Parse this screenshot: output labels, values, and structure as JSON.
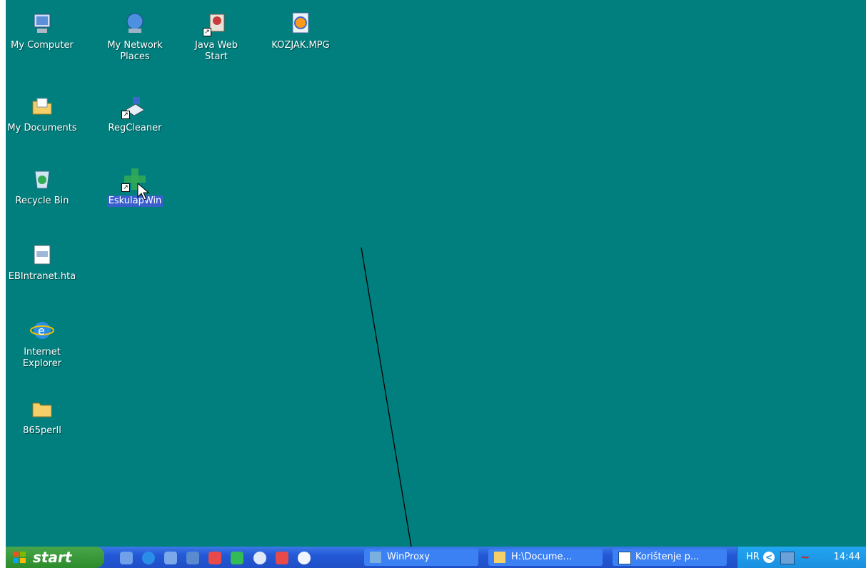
{
  "desktop": {
    "icons": [
      {
        "label": "My Computer",
        "icon": "computer-icon"
      },
      {
        "label": "My Network Places",
        "icon": "network-icon"
      },
      {
        "label": "Java Web Start",
        "icon": "java-icon"
      },
      {
        "label": "KOZJAK.MPG",
        "icon": "media-file-icon"
      },
      {
        "label": "My Documents",
        "icon": "documents-folder-icon"
      },
      {
        "label": "RegCleaner",
        "icon": "regcleaner-icon"
      },
      {
        "label": "Recycle Bin",
        "icon": "recycle-bin-icon"
      },
      {
        "label": "EskulapWin",
        "icon": "eskulap-cross-icon"
      },
      {
        "label": "EBIntranet.hta",
        "icon": "hta-file-icon"
      },
      {
        "label": "Internet Explorer",
        "icon": "internet-explorer-icon"
      },
      {
        "label": "865perll",
        "icon": "folder-icon"
      }
    ],
    "selected_label": "EskulapWin"
  },
  "taskbar": {
    "start_label": "start",
    "quick_launch": [
      "ie-settings-icon",
      "internet-explorer-icon",
      "outlook-icon",
      "network-icon",
      "msn-icon",
      "eskulap-icon",
      "help-icon",
      "stop-icon",
      "info-icon"
    ],
    "tasks": [
      {
        "label": "WinProxy",
        "icon": "winproxy-icon"
      },
      {
        "label": "H:\\Docume...",
        "icon": "folder-icon"
      },
      {
        "label": "Korištenje p...",
        "icon": "word-icon"
      }
    ],
    "tray": {
      "language": "HR",
      "clock": "14:44"
    }
  },
  "colors": {
    "desktop": "#007f7e",
    "taskbar": "#2358d6",
    "start": "#2c8c2c"
  }
}
